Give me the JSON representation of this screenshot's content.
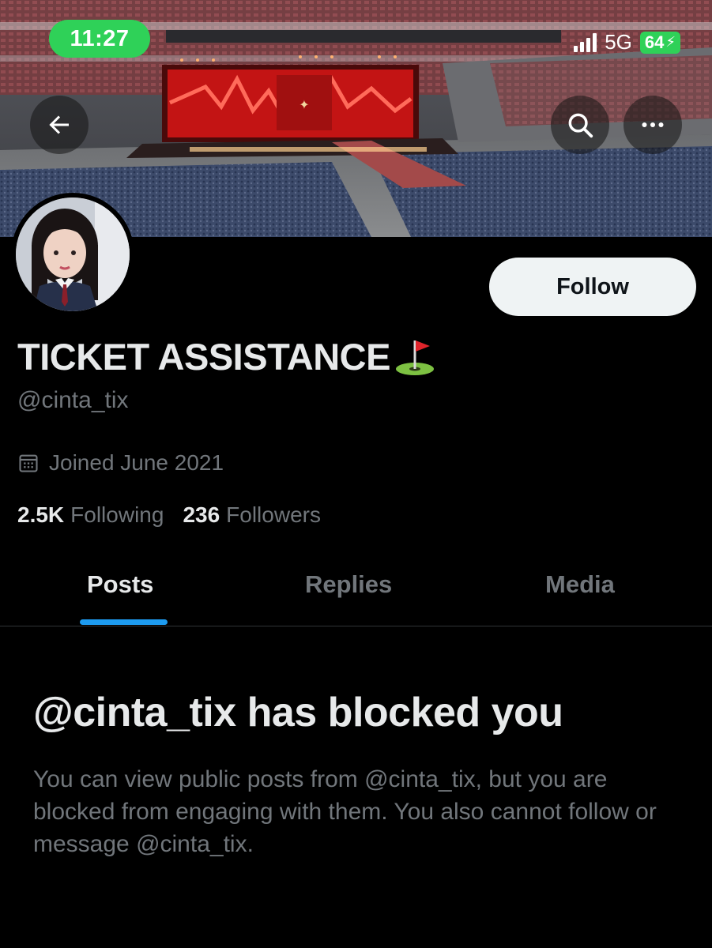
{
  "status_bar": {
    "time": "11:27",
    "network": "5G",
    "battery": "64",
    "battery_color": "#2fd158"
  },
  "header": {
    "back_icon": "arrow-left-icon",
    "search_icon": "search-icon",
    "more_icon": "more-horizontal-icon"
  },
  "profile": {
    "display_name": "TICKET ASSISTANCE",
    "name_emoji": "flag-in-hole-icon",
    "handle": "@cinta_tix",
    "joined": "Joined June 2021",
    "following_count": "2.5K",
    "following_label": "Following",
    "followers_count": "236",
    "followers_label": "Followers",
    "follow_button": "Follow"
  },
  "tabs": [
    {
      "label": "Posts",
      "active": true
    },
    {
      "label": "Replies",
      "active": false
    },
    {
      "label": "Media",
      "active": false
    }
  ],
  "blocked": {
    "title": "@cinta_tix has blocked you",
    "body": "You can view public posts from @cinta_tix, but you are blocked from engaging with them. You also cannot follow or message @cinta_tix."
  },
  "colors": {
    "background": "#000000",
    "accent": "#1d9bf0",
    "muted_text": "#71767b",
    "primary_text": "#e7e9ea"
  }
}
